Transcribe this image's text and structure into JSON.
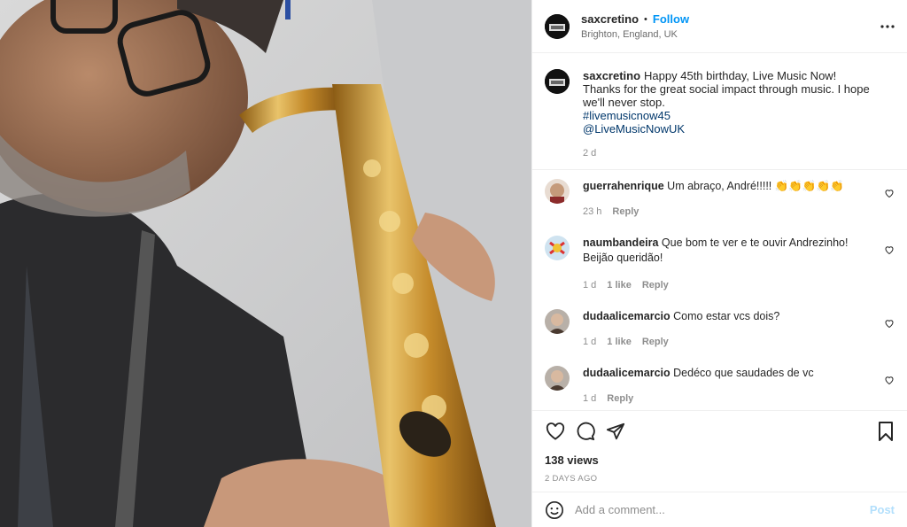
{
  "post": {
    "username": "saxcretino",
    "follow_label": "Follow",
    "separator": "•",
    "location": "Brighton, England, UK",
    "caption": {
      "line1": "Happy 45th birthday, Live Music Now!",
      "line2": "Thanks for the great social impact through music. I hope we'll never stop.",
      "hashtag": "#livemusicnow45",
      "mention": "@LiveMusicNowUK",
      "time": "2 d"
    },
    "views": "138 views",
    "posted_ago": "2 DAYS AGO"
  },
  "comments": [
    {
      "username": "guerrahenrique",
      "text": "Um abraço, André!!!!! 👏👏👏👏👏",
      "time": "23 h",
      "likes": "",
      "reply": "Reply"
    },
    {
      "username": "naumbandeira",
      "text": "Que bom te ver e te ouvir Andrezinho! Beijão queridão!",
      "time": "1 d",
      "likes": "1 like",
      "reply": "Reply"
    },
    {
      "username": "dudaalicemarcio",
      "text": "Como estar vcs dois?",
      "time": "1 d",
      "likes": "1 like",
      "reply": "Reply"
    },
    {
      "username": "dudaalicemarcio",
      "text": "Dedéco que saudades de vc",
      "time": "1 d",
      "likes": "",
      "reply": "Reply"
    }
  ],
  "add_comment": {
    "placeholder": "Add a comment...",
    "post_label": "Post"
  },
  "icons": {
    "more": "more-options-icon",
    "like": "heart-icon",
    "comment": "comment-icon",
    "share": "share-icon",
    "save": "bookmark-icon",
    "emoji": "emoji-icon"
  },
  "colors": {
    "link_blue": "#0095f6",
    "hashtag": "#00376b",
    "muted": "#8e8e8e",
    "post_disabled": "#b2dffc"
  }
}
